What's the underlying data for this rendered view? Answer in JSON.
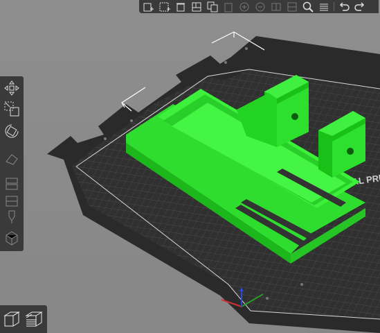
{
  "app": {
    "accent_color": "#00ff00",
    "bed_color": "#2a2a2a"
  },
  "top_toolbar": {
    "buttons": [
      {
        "icon": "add-object-icon",
        "enabled": true
      },
      {
        "icon": "select-all-icon",
        "enabled": true
      },
      {
        "icon": "delete-icon",
        "enabled": true
      },
      {
        "icon": "arrange-icon",
        "enabled": true
      },
      {
        "icon": "copy-icon",
        "enabled": true
      },
      {
        "icon": "paste-icon",
        "enabled": false
      },
      {
        "icon": "add-instance-icon",
        "enabled": false
      },
      {
        "icon": "remove-instance-icon",
        "enabled": false
      },
      {
        "icon": "split-objects-icon",
        "enabled": false
      },
      {
        "icon": "split-parts-icon",
        "enabled": false
      },
      {
        "icon": "search-icon",
        "enabled": true
      },
      {
        "icon": "layers-editing-icon",
        "enabled": true
      },
      {
        "icon": "undo-icon",
        "enabled": true
      },
      {
        "icon": "redo-icon",
        "enabled": true
      }
    ]
  },
  "left_toolbar": {
    "tools": [
      {
        "icon": "move-icon",
        "enabled": true
      },
      {
        "icon": "scale-icon",
        "enabled": true
      },
      {
        "icon": "rotate-icon",
        "enabled": true
      },
      {
        "icon": "place-on-face-icon",
        "enabled": false
      },
      {
        "icon": "cut-icon",
        "enabled": false
      },
      {
        "icon": "paint-supports-icon",
        "enabled": false
      },
      {
        "icon": "seam-painting-icon",
        "enabled": false
      },
      {
        "icon": "hollow-icon",
        "enabled": false
      }
    ]
  },
  "view_toggle": {
    "buttons": [
      {
        "icon": "3d-view-icon"
      },
      {
        "icon": "preview-layers-icon"
      }
    ]
  },
  "bed": {
    "label_text": "NAL PRUS"
  }
}
